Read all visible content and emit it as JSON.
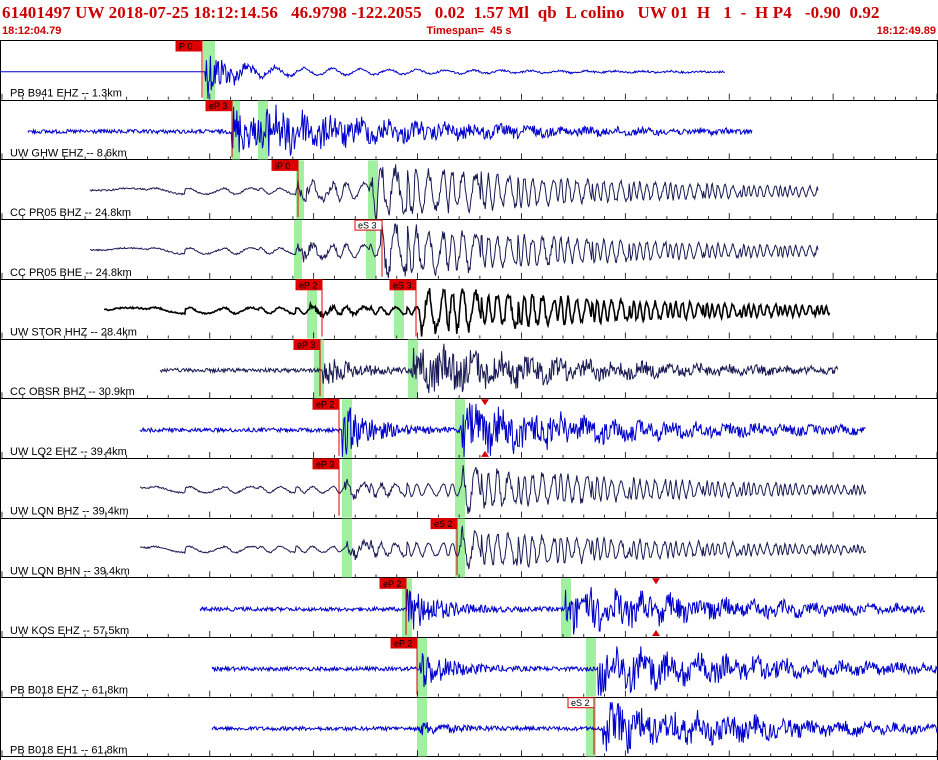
{
  "header": {
    "title": "61401497 UW 2018-07-25 18:12:14.56   46.9798 -122.2055   0.02  1.57 Ml  qb  L colino   UW 01  H   1  -  H P4   -0.90  0.92",
    "start_time": "18:12:04.79",
    "timespan": "Timespan=  45 s",
    "end_time": "18:12:49.89"
  },
  "colors": {
    "pick_fill": "#dd0000",
    "window_fill": "#a0f0a0",
    "blue_trace": "#0000cc",
    "dark_trace": "#1a1a55",
    "black_trace": "#000000",
    "header_text": "#cc0000"
  },
  "traces": [
    {
      "label": "PB B941 EHZ -- 1.3km",
      "color": "blue",
      "picks": [
        {
          "label": "P 0",
          "style": "filled"
        }
      ]
    },
    {
      "label": "UW GHW EHZ -- 8.6km",
      "color": "blue",
      "picks": [
        {
          "label": "eP 3",
          "style": "filled"
        }
      ]
    },
    {
      "label": "CC PR05 BHZ -- 24.8km",
      "color": "dark",
      "picks": [
        {
          "label": "iP 0",
          "style": "filled"
        }
      ]
    },
    {
      "label": "CC PR05 BHE -- 24.8km",
      "color": "dark",
      "picks": [
        {
          "label": "eS 3",
          "style": "outline"
        }
      ]
    },
    {
      "label": "UW STOR HHZ -- 28.4km",
      "color": "black",
      "picks": [
        {
          "label": "eP 2",
          "style": "filled"
        },
        {
          "label": "eS 3",
          "style": "filled"
        }
      ]
    },
    {
      "label": "CC OBSR BHZ -- 30.9km",
      "color": "dark",
      "picks": [
        {
          "label": "eP 3",
          "style": "filled"
        }
      ]
    },
    {
      "label": "UW LQ2 EHZ -- 39.4km",
      "color": "blue",
      "picks": [
        {
          "label": "eP 2",
          "style": "filled"
        }
      ]
    },
    {
      "label": "UW LQN BHZ -- 39.4km",
      "color": "dark",
      "picks": [
        {
          "label": "eP 3",
          "style": "filled"
        }
      ]
    },
    {
      "label": "UW LQN BHN -- 39.4km",
      "color": "dark",
      "picks": [
        {
          "label": "eS 2",
          "style": "filled"
        }
      ]
    },
    {
      "label": "UW KOS EHZ -- 57.5km",
      "color": "blue",
      "picks": [
        {
          "label": "eP 2",
          "style": "filled"
        }
      ]
    },
    {
      "label": "PB B018 EHZ -- 61.8km",
      "color": "blue",
      "picks": [
        {
          "label": "eP 2",
          "style": "filled"
        }
      ]
    },
    {
      "label": "PB B018 EH1 -- 61.8km",
      "color": "blue",
      "picks": [
        {
          "label": "eS 2",
          "style": "outline"
        }
      ]
    }
  ]
}
